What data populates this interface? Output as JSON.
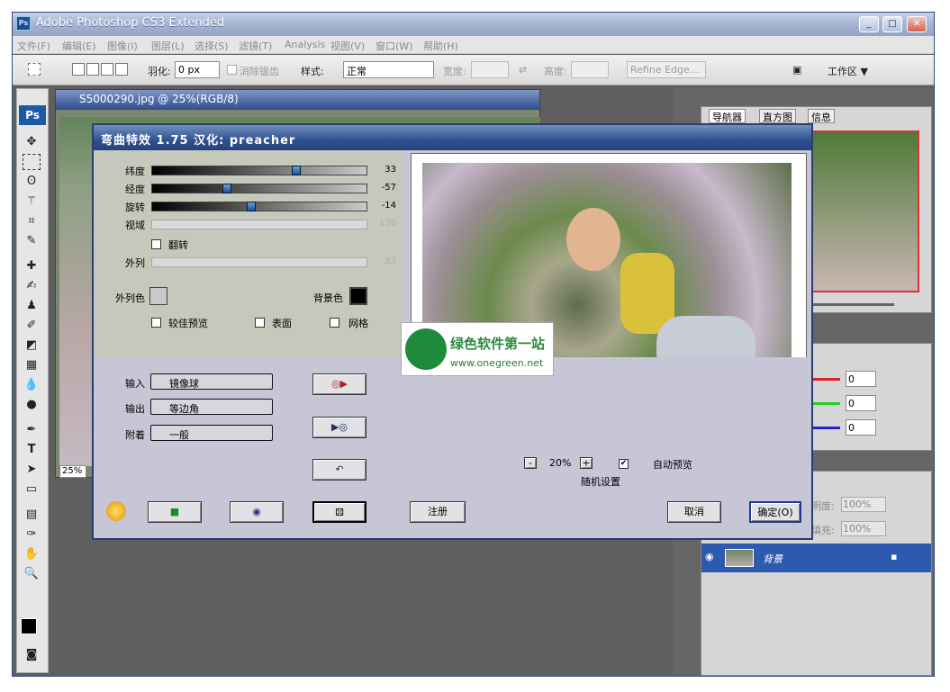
{
  "window": {
    "title": "Adobe Photoshop CS3 Extended",
    "logo": "Ps"
  },
  "menu": [
    "文件(F)",
    "编辑(E)",
    "图像(I)",
    "图层(L)",
    "选择(S)",
    "滤镜(T)",
    "Analysis",
    "视图(V)",
    "窗口(W)",
    "帮助(H)"
  ],
  "options": {
    "feather_label": "羽化:",
    "feather_value": "0 px",
    "antialias_label": "消除锯齿",
    "style_label": "样式:",
    "style_value": "正常",
    "width_label": "宽度:",
    "height_label": "高度:",
    "refine_edge": "Refine Edge...",
    "workspace": "工作区 ▼"
  },
  "document": {
    "title": "S5000290.jpg @ 25%(RGB/8)",
    "zoom": "25%"
  },
  "panels": {
    "nav_tabs": [
      "导航器",
      "直方图",
      "信息"
    ],
    "color_values": [
      "0",
      "0",
      "0"
    ],
    "layers": {
      "opacity_label": "明度:",
      "opacity_value": "100%",
      "fill_label": "填充:",
      "fill_value": "100%",
      "layer_name": "背景"
    }
  },
  "dialog": {
    "title": "弯曲特效 1.75   汉化: preacher",
    "sliders": [
      {
        "label": "纬度",
        "value": "33",
        "pos": 0.68,
        "enabled": true
      },
      {
        "label": "经度",
        "value": "-57",
        "pos": 0.35,
        "enabled": true
      },
      {
        "label": "旋转",
        "value": "-14",
        "pos": 0.46,
        "enabled": true
      },
      {
        "label": "视域",
        "value": "120",
        "pos": null,
        "enabled": false
      }
    ],
    "flip_label": "翻转",
    "outer_label": "外列",
    "outer_value": "33",
    "outer_color_label": "外列色",
    "bg_color_label": "背景色",
    "options": [
      "较佳预览",
      "表面",
      "网格"
    ],
    "input_label": "输入",
    "input_value": "镜像球",
    "output_label": "输出",
    "output_value": "等边角",
    "attach_label": "附着",
    "attach_value": "一般",
    "zoom_value": "20%",
    "zoom_minus": "-",
    "zoom_plus": "+",
    "random_label": "随机设置",
    "auto_preview_label": "自动预览",
    "register_label": "注册",
    "cancel_label": "取消",
    "ok_label": "确定(O)",
    "watermark_cn": "绿色软件第一站",
    "watermark_url": "www.onegreen.net"
  }
}
